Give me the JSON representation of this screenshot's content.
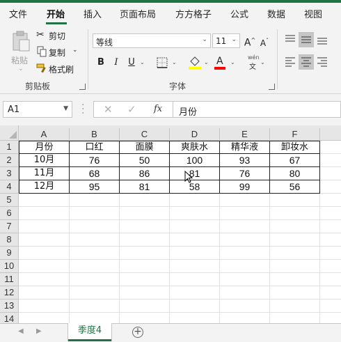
{
  "ribbon_tabs": [
    {
      "label": "文件"
    },
    {
      "label": "开始"
    },
    {
      "label": "插入"
    },
    {
      "label": "页面布局"
    },
    {
      "label": "方方格子"
    },
    {
      "label": "公式"
    },
    {
      "label": "数据"
    },
    {
      "label": "视图"
    }
  ],
  "active_tab": "开始",
  "clipboard": {
    "paste_label": "粘贴",
    "cut_label": "剪切",
    "copy_label": "复制",
    "format_painter_label": "格式刷",
    "group_label": "剪贴板"
  },
  "font": {
    "font_name": "等线",
    "font_size": "11",
    "grow_label": "A",
    "shrink_label": "A",
    "bold_label": "B",
    "italic_label": "I",
    "underline_label": "U",
    "font_color_label": "A",
    "phonetic_top": "wén",
    "phonetic_bottom": "文",
    "group_label": "字体",
    "highlight_color": "#ffff00",
    "font_color": "#ff0000"
  },
  "formula_bar": {
    "name_box": "A1",
    "fx_label": "fx",
    "content": "月份"
  },
  "columns": [
    "A",
    "B",
    "C",
    "D",
    "E",
    "F"
  ],
  "rows": [
    "1",
    "2",
    "3",
    "4",
    "5",
    "6",
    "7",
    "8",
    "9",
    "10",
    "11",
    "12",
    "13",
    "14"
  ],
  "table": {
    "header": [
      "月份",
      "口红",
      "面膜",
      "爽肤水",
      "精华液",
      "卸妆水"
    ],
    "data": [
      [
        "10月",
        "76",
        "50",
        "100",
        "93",
        "67"
      ],
      [
        "11月",
        "68",
        "86",
        "81",
        "76",
        "80"
      ],
      [
        "12月",
        "95",
        "81",
        "58",
        "99",
        "56"
      ]
    ]
  },
  "sheet_tabs": [
    {
      "label": "季度4"
    }
  ],
  "accent_color": "#217346"
}
